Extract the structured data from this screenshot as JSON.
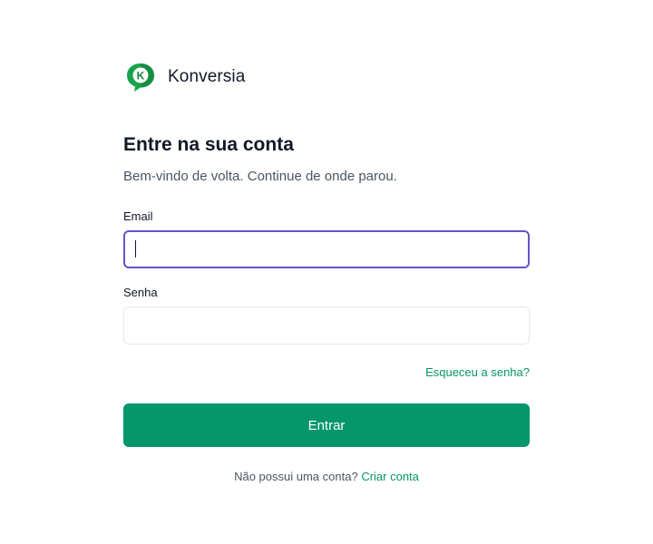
{
  "brand": {
    "name": "Konversia",
    "logo_letter": "K",
    "logo_color": "#16a34a"
  },
  "login": {
    "title": "Entre na sua conta",
    "subtitle": "Bem-vindo de volta. Continue de onde parou.",
    "email_label": "Email",
    "email_value": "",
    "password_label": "Senha",
    "password_value": "",
    "forgot_label": "Esqueceu a senha?",
    "submit_label": "Entrar",
    "signup_prompt": "Não possui uma conta?",
    "signup_link": "Criar conta"
  },
  "colors": {
    "primary": "#05966a",
    "link": "#059669",
    "focus_border": "#6a52c9"
  }
}
